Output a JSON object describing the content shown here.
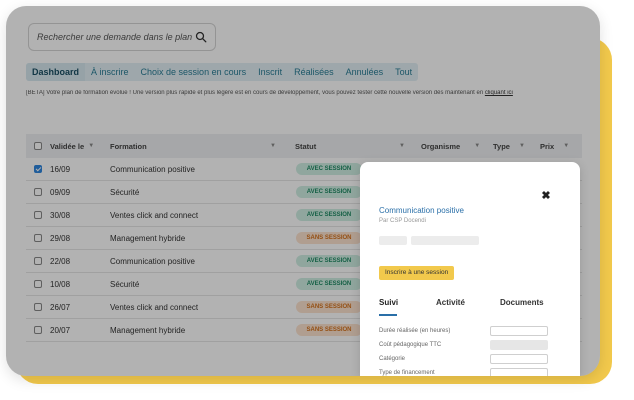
{
  "search": {
    "placeholder": "Rechercher une demande dans le plan"
  },
  "tabs": [
    {
      "label": "Dashboard",
      "active": true
    },
    {
      "label": "À inscrire",
      "active": false
    },
    {
      "label": "Choix de session en cours",
      "active": false
    },
    {
      "label": "Inscrit",
      "active": false
    },
    {
      "label": "Réalisées",
      "active": false
    },
    {
      "label": "Annulées",
      "active": false
    },
    {
      "label": "Tout",
      "active": false
    }
  ],
  "beta_note": {
    "text": "[BETA] Votre plan de formation évolue ! Une version plus rapide et plus légère est en cours de développement, vous pouvez tester cette nouvelle version dès maintenant en",
    "link": "cliquant ici"
  },
  "table": {
    "headers": {
      "validated": "Validée le",
      "formation": "Formation",
      "statut": "Statut",
      "organisme": "Organisme",
      "type": "Type",
      "prix": "Prix"
    },
    "rows": [
      {
        "checked": true,
        "date": "16/09",
        "formation": "Communication positive",
        "status": "AVEC SESSION",
        "status_kind": "avec"
      },
      {
        "checked": false,
        "date": "09/09",
        "formation": "Sécurité",
        "status": "AVEC SESSION",
        "status_kind": "avec"
      },
      {
        "checked": false,
        "date": "30/08",
        "formation": "Ventes click and connect",
        "status": "AVEC SESSION",
        "status_kind": "avec"
      },
      {
        "checked": false,
        "date": "29/08",
        "formation": "Management hybride",
        "status": "SANS SESSION",
        "status_kind": "sans"
      },
      {
        "checked": false,
        "date": "22/08",
        "formation": "Communication positive",
        "status": "AVEC SESSION",
        "status_kind": "avec"
      },
      {
        "checked": false,
        "date": "10/08",
        "formation": "Sécurité",
        "status": "AVEC SESSION",
        "status_kind": "avec"
      },
      {
        "checked": false,
        "date": "26/07",
        "formation": "Ventes click and connect",
        "status": "SANS SESSION",
        "status_kind": "sans"
      },
      {
        "checked": false,
        "date": "20/07",
        "formation": "Management hybride",
        "status": "SANS SESSION",
        "status_kind": "sans"
      }
    ]
  },
  "panel": {
    "title": "Communication positive",
    "subtitle": "Par CSP Docendi",
    "close_symbol": "✖",
    "inscrire_label": "Inscrire à une session",
    "tabs": [
      "Suivi",
      "Activité",
      "Documents"
    ],
    "fields": [
      {
        "label": "Durée réalisée (en heures)",
        "disabled": false
      },
      {
        "label": "Coût pédagogique TTC",
        "disabled": true
      },
      {
        "label": "Catégorie",
        "disabled": false
      },
      {
        "label": "Type de financement",
        "disabled": false
      }
    ]
  },
  "colors": {
    "accent_yellow": "#f2c94c",
    "tab_text": "#2a7d96",
    "avec_session": "#1f8a64",
    "sans_session": "#d4721c",
    "panel_title": "#2a6fa8"
  }
}
